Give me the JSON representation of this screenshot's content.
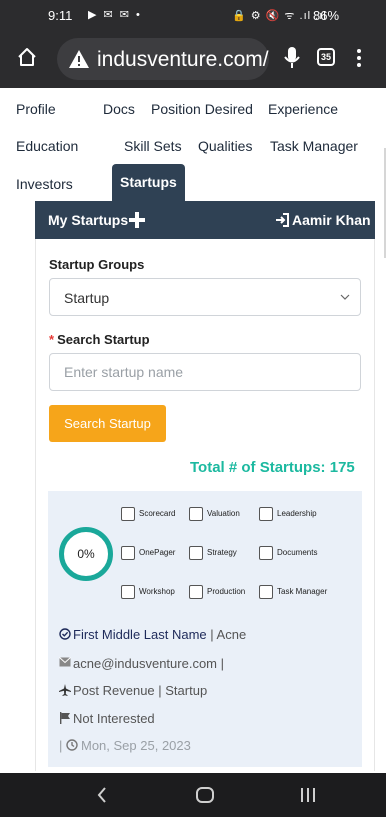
{
  "status_bar": {
    "time": "9:11",
    "left_icons": "▶ ✉ ✉ •",
    "right_icons": "🔒 ⚙ 🔇 ᯤ .ıl .ıl",
    "battery": "86%"
  },
  "browser": {
    "url": "indusventure.com/",
    "tab_count": "35"
  },
  "nav_menu": {
    "items": [
      {
        "label": "Profile"
      },
      {
        "label": "Docs"
      },
      {
        "label": "Position Desired"
      },
      {
        "label": "Experience"
      },
      {
        "label": "Education"
      },
      {
        "label": "Skill Sets"
      },
      {
        "label": "Qualities"
      },
      {
        "label": "Task Manager"
      },
      {
        "label": "Investors"
      },
      {
        "label": "Startups"
      }
    ],
    "active": "Startups"
  },
  "card": {
    "title": "My Startups",
    "user_name": "Aamir Khan",
    "groups_label": "Startup Groups",
    "groups_selected": "Startup",
    "search_label": "Search Startup",
    "search_placeholder": "Enter startup name",
    "search_button": "Search Startup",
    "total_text": "Total # of Startups: 175"
  },
  "startup_item": {
    "progress_text": "0%",
    "progress_fraction": 0,
    "checkboxes": [
      {
        "label": "Scorecard"
      },
      {
        "label": "Valuation"
      },
      {
        "label": "Leadership"
      },
      {
        "label": "OnePager"
      },
      {
        "label": "Strategy"
      },
      {
        "label": "Documents"
      },
      {
        "label": "Workshop"
      },
      {
        "label": "Production"
      },
      {
        "label": "Task Manager"
      }
    ],
    "name": "First Middle Last Name",
    "company": "| Acne",
    "email": "acne@indusventure.com |",
    "stage": "Post Revenue | Startup",
    "status": "Not Interested",
    "date_prefix": "|",
    "date": "Mon, Sep 25, 2023"
  },
  "colors": {
    "header_bg": "#2f4154",
    "accent_orange": "#f6a51a",
    "accent_teal": "#1cb9a0",
    "item_bg": "#eaf0f8"
  }
}
